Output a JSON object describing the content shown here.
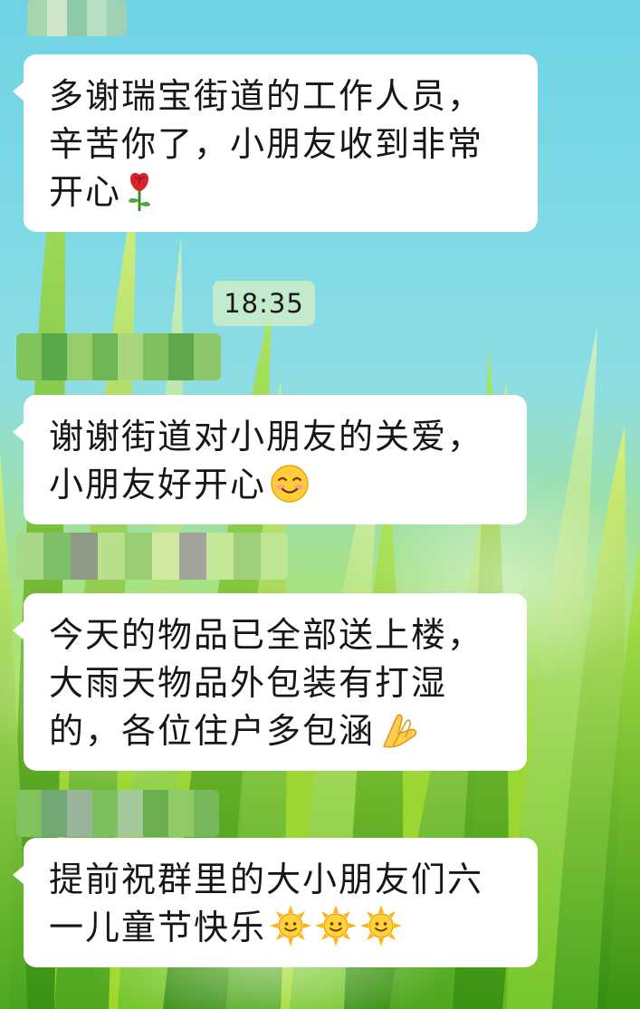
{
  "chat": {
    "timestamp": "18:35",
    "messages": [
      {
        "lines": [
          "多谢瑞宝街道的工作人员，",
          "辛苦你了，小朋友收到非常",
          "开心"
        ],
        "trailing_emoji": [
          "rose-emoji"
        ]
      },
      {
        "lines": [
          "谢谢街道对小朋友的关爱，",
          "小朋友好开心"
        ],
        "trailing_emoji": [
          "smiling-face-emoji"
        ]
      },
      {
        "lines": [
          "今天的物品已全部送上楼，",
          "大雨天物品外包装有打湿",
          "的，各位住户多包涵"
        ],
        "trailing_emoji": [
          "folded-hands-emoji"
        ]
      },
      {
        "lines": [
          "提前祝群里的大小朋友们六",
          "一儿童节快乐"
        ],
        "trailing_emoji": [
          "sun-with-face-emoji",
          "sun-with-face-emoji",
          "sun-with-face-emoji"
        ]
      }
    ]
  },
  "colors": {
    "bubble_background": "#ffffff",
    "text": "#161616",
    "background_sky": "#7fd9e6",
    "background_grass": "#9bd632"
  }
}
